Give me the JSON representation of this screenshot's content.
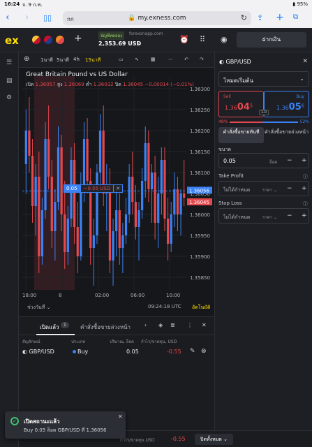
{
  "status_bar": {
    "time": "16:24",
    "date": "จ. 9 ก.พ.",
    "battery": "95%"
  },
  "browser": {
    "aa": "กก",
    "host": "my.exness.com"
  },
  "topbar": {
    "logo": "ex",
    "account_type": "บัญชีทดลอง",
    "server": "forexonapp.com",
    "balance": "2,353.69 USD",
    "deposit_label": "ฝากเงิน"
  },
  "chart_toolbar": {
    "tf_1m": "1นาที",
    "tf_5m": "5นาที",
    "tf_4h": "4h",
    "tf_15m": "15นาที"
  },
  "chart": {
    "title": "Great Britain Pound vs US Dollar",
    "open_label": "เปิด",
    "open": "1.36057",
    "high_label": "สูง",
    "high": "1.36069",
    "low_label": "ต่ำ",
    "low": "1.36032",
    "close_label": "ปิด",
    "close": "1.36045",
    "change": "−0.00014 (−0.01%)",
    "position_volume": "0.05",
    "position_pl": "−0.55 USD",
    "range_label": "ช่วงวันที่",
    "clock": "09:24:18 UTC",
    "auto_scale": "อัตโนมัติ"
  },
  "chart_data": {
    "type": "candlestick",
    "y_ticks": [
      "1.36300",
      "1.36250",
      "1.36200",
      "1.36150",
      "1.36100",
      "1.36050",
      "1.36000",
      "1.35950",
      "1.35900",
      "1.35850"
    ],
    "ylim": [
      1.3582,
      1.3633
    ],
    "x_ticks": [
      "18:00",
      "8",
      "02:00",
      "06:00",
      "10:00"
    ],
    "price_labels": {
      "ask": "1.36056",
      "bid": "1.36045"
    },
    "position_price": 1.36056,
    "candles": [
      [
        1.3612,
        1.3625,
        1.3605,
        1.362
      ],
      [
        1.362,
        1.3628,
        1.361,
        1.3614
      ],
      [
        1.3614,
        1.3618,
        1.3598,
        1.3602
      ],
      [
        1.3602,
        1.3612,
        1.3595,
        1.3609
      ],
      [
        1.3609,
        1.3615,
        1.3586,
        1.359
      ],
      [
        1.359,
        1.3604,
        1.3588,
        1.3601
      ],
      [
        1.3601,
        1.3622,
        1.3599,
        1.3618
      ],
      [
        1.3618,
        1.3626,
        1.3606,
        1.3609
      ],
      [
        1.3609,
        1.3613,
        1.3592,
        1.3596
      ],
      [
        1.3596,
        1.3606,
        1.3589,
        1.3603
      ],
      [
        1.3603,
        1.3621,
        1.3601,
        1.3616
      ],
      [
        1.3616,
        1.3619,
        1.3596,
        1.36
      ],
      [
        1.36,
        1.3608,
        1.3587,
        1.3591
      ],
      [
        1.3591,
        1.3602,
        1.3588,
        1.3599
      ],
      [
        1.3599,
        1.3616,
        1.3597,
        1.3613
      ],
      [
        1.3613,
        1.3617,
        1.3593,
        1.3597
      ],
      [
        1.3597,
        1.3603,
        1.3586,
        1.359
      ],
      [
        1.359,
        1.361,
        1.3589,
        1.3607
      ],
      [
        1.3607,
        1.3622,
        1.3603,
        1.3618
      ],
      [
        1.3618,
        1.3623,
        1.3605,
        1.3608
      ],
      [
        1.3608,
        1.3611,
        1.3588,
        1.3592
      ],
      [
        1.3592,
        1.3599,
        1.3583,
        1.3595
      ],
      [
        1.3595,
        1.3612,
        1.3593,
        1.361
      ],
      [
        1.361,
        1.3624,
        1.3606,
        1.362
      ],
      [
        1.362,
        1.3626,
        1.3602,
        1.3605
      ],
      [
        1.3605,
        1.3612,
        1.3596,
        1.3607
      ],
      [
        1.3607,
        1.3611,
        1.3586,
        1.3589
      ],
      [
        1.3589,
        1.3599,
        1.3583,
        1.3596
      ],
      [
        1.3596,
        1.3606,
        1.359,
        1.3601
      ],
      [
        1.3601,
        1.3605,
        1.3588,
        1.3592
      ],
      [
        1.3592,
        1.3598,
        1.3586,
        1.3595
      ],
      [
        1.3595,
        1.3604,
        1.3593,
        1.36
      ],
      [
        1.36,
        1.3612,
        1.3598,
        1.3609
      ],
      [
        1.3609,
        1.3615,
        1.36,
        1.3603
      ],
      [
        1.3603,
        1.3607,
        1.3594,
        1.3597
      ],
      [
        1.3597,
        1.3603,
        1.3589,
        1.3601
      ],
      [
        1.3601,
        1.3611,
        1.3599,
        1.3608
      ],
      [
        1.3608,
        1.3621,
        1.3604,
        1.3617
      ],
      [
        1.3617,
        1.362,
        1.3603,
        1.3606
      ],
      [
        1.3606,
        1.3612,
        1.3598,
        1.361
      ],
      [
        1.361,
        1.3614,
        1.3594,
        1.3598
      ],
      [
        1.3598,
        1.3609,
        1.3592,
        1.3605
      ],
      [
        1.3605,
        1.3616,
        1.36,
        1.3613
      ],
      [
        1.3613,
        1.3616,
        1.3596,
        1.3599
      ],
      [
        1.3599,
        1.3604,
        1.3589,
        1.3593
      ],
      [
        1.3593,
        1.3603,
        1.3591,
        1.36
      ],
      [
        1.36,
        1.361,
        1.3597,
        1.3606
      ],
      [
        1.3606,
        1.3609,
        1.3596,
        1.36
      ],
      [
        1.36,
        1.3606,
        1.3595,
        1.3605
      ],
      [
        1.3605,
        1.3613,
        1.3602,
        1.3604
      ]
    ]
  },
  "bottom": {
    "tab_open": "เปิดแล้ว",
    "tab_open_count": "1",
    "tab_pending": "คำสั่งซื้อขายล่วงหน้า",
    "col_symbol": "สัญลักษณ์",
    "col_type": "ประเภท",
    "col_volume": "ปริมาณ, ล็อต",
    "col_pl": "กำไร/ขาดทุน, USD",
    "row": {
      "symbol": "GBP/USD",
      "type": "Buy",
      "volume": "0.05",
      "pl": "-0.55"
    },
    "footer_text": "กำไร/ขาดทุน USD",
    "footer_pl": "-0.55",
    "close_all": "ปิดทั้งหมด"
  },
  "toast": {
    "title": "เปิดสถานะแล้ว",
    "message": "Buy 0.05 ล็อต GBP/USD ที่ 1.36056"
  },
  "order_panel": {
    "symbol": "GBP/USD",
    "mode": "โหมดเริ่มต้น",
    "sell_label": "Sell",
    "sell_price_small": "1.36",
    "sell_price_big": "04",
    "sell_price_sup": "5",
    "buy_label": "Buy",
    "buy_price_small": "1.36",
    "buy_price_big": "05",
    "buy_price_sup": "6",
    "spread": "1.0",
    "sell_pct": "48%",
    "buy_pct": "52%",
    "sell_fraction": 0.48,
    "market_label": "คำสั่งซื้อขายทันที",
    "pending_label": "คำสั่งซื้อขายล่วงหน้า",
    "volume_label": "ขนาด",
    "volume_value": "0.05",
    "volume_unit": "ล็อต",
    "tp_label": "Take Profit",
    "tp_value": "ไม่ได้กำหนด",
    "tp_unit": "ราคา",
    "sl_label": "Stop Loss",
    "sl_value": "ไม่ได้กำหนด",
    "sl_unit": "ราคา"
  }
}
